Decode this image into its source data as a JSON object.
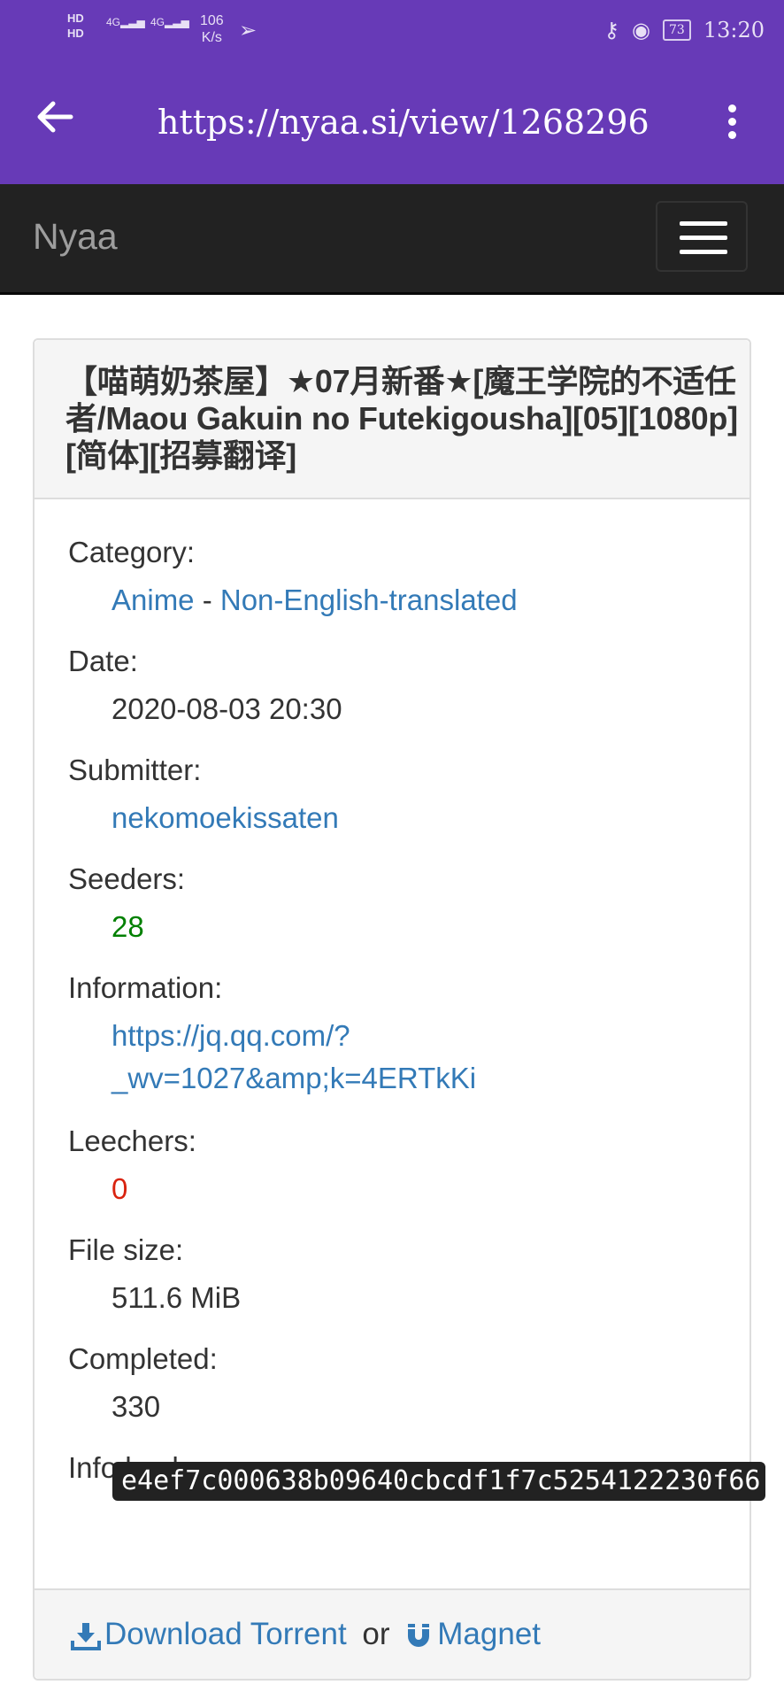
{
  "status_bar": {
    "hd1": "HD",
    "hd2": "HD",
    "signal1": "4G",
    "signal2": "4G",
    "speed_value": "106",
    "speed_unit": "K/s",
    "battery": "73",
    "time": "13:20"
  },
  "toolbar": {
    "url": "https://nyaa.si/view/1268296"
  },
  "navbar": {
    "brand": "Nyaa"
  },
  "torrent": {
    "title": "【喵萌奶茶屋】★07月新番★[魔王学院的不适任者/Maou Gakuin no Futekigousha][05][1080p][简体][招募翻译]",
    "category_label": "Category:",
    "category_main": "Anime",
    "category_sep": " - ",
    "category_sub": "Non-English-translated",
    "date_label": "Date:",
    "date": "2020-08-03 20:30",
    "submitter_label": "Submitter:",
    "submitter": "nekomoekissaten",
    "seeders_label": "Seeders:",
    "seeders": "28",
    "information_label": "Information:",
    "information_line1": "https://jq.qq.com/?",
    "information_line2": "_wv=1027&amp;k=4ERTkKi",
    "leechers_label": "Leechers:",
    "leechers": "0",
    "filesize_label": "File size:",
    "filesize": "511.6 MiB",
    "completed_label": "Completed:",
    "completed": "330",
    "infohash_label": "Info hash:",
    "infohash": "e4ef7c000638b09640cbcdf1f7c5254122230f66"
  },
  "footer": {
    "download_label": "Download Torrent",
    "or_text": "or",
    "magnet_label": "Magnet"
  },
  "colors": {
    "header_purple": "#673ab7",
    "navbar_dark": "#222222",
    "link_blue": "#337ab7",
    "seeders_green": "#008000",
    "leechers_red": "#d9230f"
  }
}
